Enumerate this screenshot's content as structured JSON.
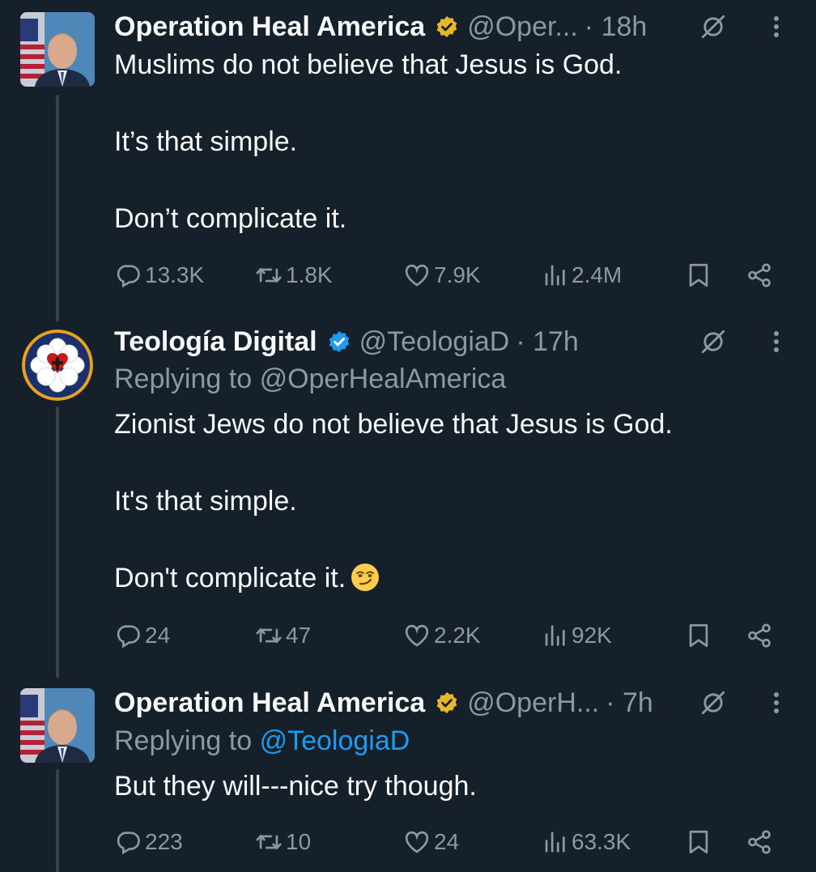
{
  "tweets": [
    {
      "name": "Operation Heal America",
      "handle": "@Oper...",
      "meta": "· 18h",
      "badge": "gold",
      "reply_prefix": "",
      "reply_handle": "",
      "text": "Muslims do not believe that Jesus is God.\n\nIt’s that simple.\n\nDon’t complicate it.",
      "emoji": false,
      "stats": {
        "replies": "13.3K",
        "reposts": "1.8K",
        "likes": "7.9K",
        "views": "2.4M"
      }
    },
    {
      "name": "Teología Digital",
      "handle": "@TeologiaD",
      "meta": "· 17h",
      "badge": "blue",
      "reply_prefix": "Replying to",
      "reply_handle": "@OperHealAmerica",
      "text": "Zionist Jews do not believe that Jesus is God.\n\nIt's that simple.\n\nDon't complicate it.",
      "emoji": true,
      "stats": {
        "replies": "24",
        "reposts": "47",
        "likes": "2.2K",
        "views": "92K"
      }
    },
    {
      "name": "Operation Heal America",
      "handle": "@OperH...",
      "meta": "· 7h",
      "badge": "gold",
      "reply_prefix": "Replying to",
      "reply_handle": "@TeologiaD",
      "text": "But they will---nice try though.",
      "emoji": false,
      "stats": {
        "replies": "223",
        "reposts": "10",
        "likes": "24",
        "views": "63.3K"
      }
    }
  ],
  "icons": {
    "reply": "reply-icon",
    "repost": "repost-icon",
    "like": "heart-icon",
    "views": "views-icon",
    "bookmark": "bookmark-icon",
    "share": "share-icon",
    "grok": "grok-icon",
    "more": "more-vertical-icon",
    "gold_badge": "gold-verified-badge-icon",
    "blue_badge": "blue-verified-badge-icon"
  },
  "colors": {
    "background": "#15202b",
    "text": "#f7f9f9",
    "muted": "#8b98a5",
    "link": "#1d9bf0",
    "gold": "#e8b82b",
    "blue": "#1d9bf0"
  }
}
